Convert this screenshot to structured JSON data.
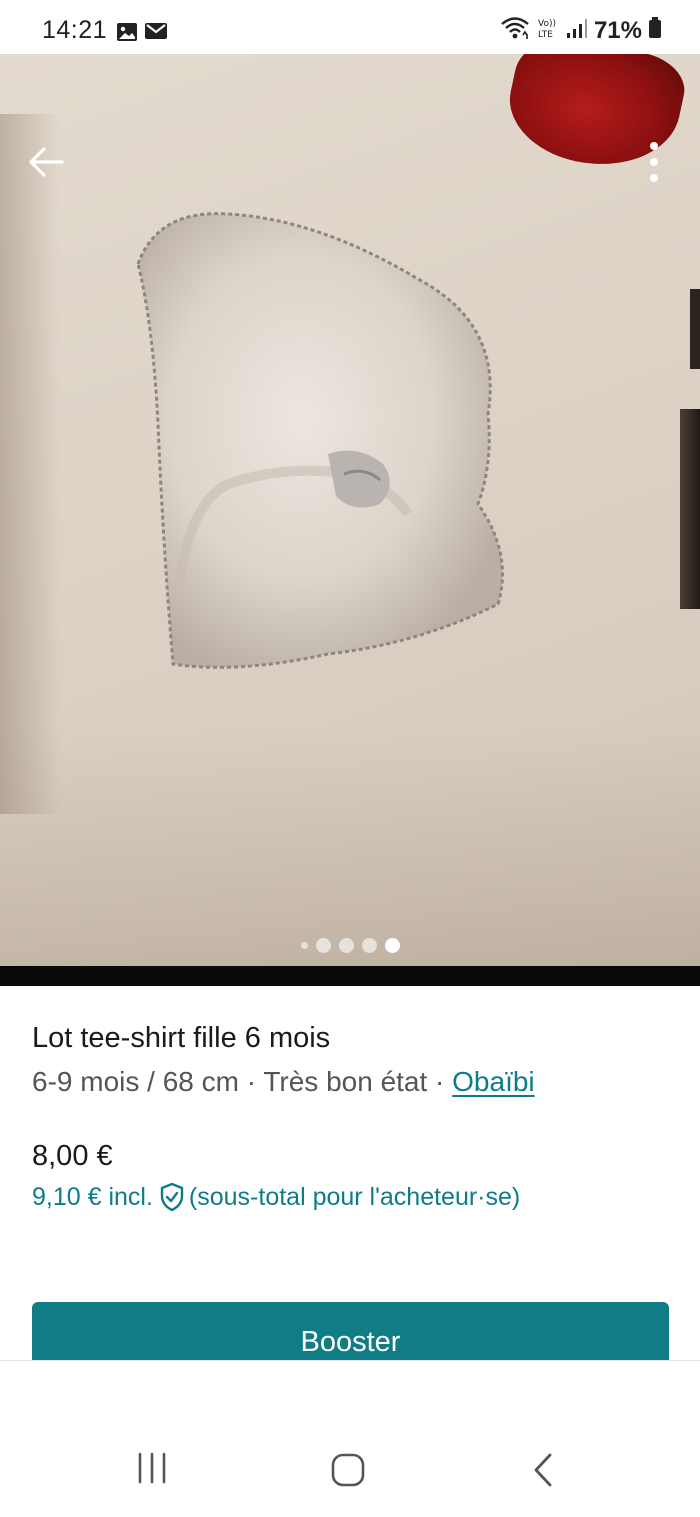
{
  "status_bar": {
    "time": "14:21",
    "left_icons": [
      "gallery-icon",
      "mail-icon"
    ],
    "right_icons": [
      "wifi-icon",
      "volte-icon",
      "signal-icon"
    ],
    "volte_label": "Vo)) LTE",
    "battery_percent": "71%"
  },
  "photo": {
    "carousel_total": 5,
    "carousel_active_index": 4
  },
  "listing": {
    "title": "Lot tee-shirt fille 6 mois",
    "size_condition": "6-9 mois / 68 cm · Très bon état · ",
    "brand": "Obaïbi",
    "price": "8,00 €",
    "price_incl_prefix": "9,10 € incl.",
    "price_incl_suffix": "(sous-total pour l'acheteur·se)"
  },
  "actions": {
    "booster_label": "Booster"
  },
  "colors": {
    "accent": "#0f7c86",
    "link": "#0d7c8a"
  }
}
